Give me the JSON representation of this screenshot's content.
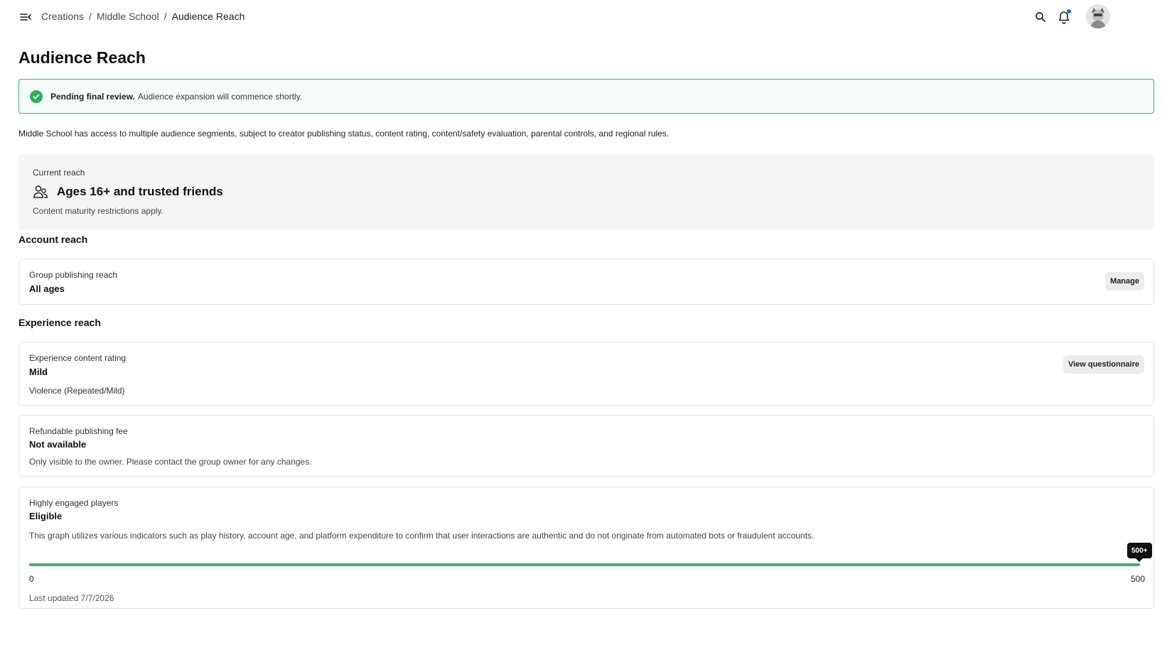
{
  "nav": {
    "menu_icon": "menu-collapse-icon",
    "breadcrumb": [
      "Creations",
      "Middle School",
      "Audience Reach"
    ],
    "separator": "/",
    "search_icon": "search-icon",
    "bell_icon": "bell-icon",
    "notification_dot_color": "#335fff"
  },
  "page": {
    "title": "Audience Reach"
  },
  "alert": {
    "icon": "check-circle-icon",
    "title": "Pending final review.",
    "text": "Audience expansion will commence shortly.",
    "color": "#3cb36a"
  },
  "intro": "Middle School has access to multiple audience segments, subject to creator publishing status, content rating, content/safety evaluation, parental controls, and regional rules.",
  "current_reach": {
    "label": "Current reach",
    "icon": "people-icon",
    "value": "Ages 16+ and trusted friends",
    "note": "Content maturity restrictions apply."
  },
  "account_reach": {
    "heading": "Account reach",
    "group": {
      "label": "Group publishing reach",
      "value": "All ages",
      "button": "Manage"
    }
  },
  "experience_reach": {
    "heading": "Experience reach",
    "rating": {
      "label": "Experience content rating",
      "value": "Mild",
      "descriptor": "Violence (Repeated/Mild)",
      "button": "View questionnaire"
    },
    "fee": {
      "label": "Refundable publishing fee",
      "value": "Not available",
      "text": "Only visible to the owner. Please contact the group owner for any changes."
    },
    "engaged": {
      "label": "Highly engaged players",
      "value": "Eligible",
      "text": "This graph utilizes various indicators such as play history, account age, and platform expenditure to confirm that user interactions are authentic and do not originate from automated bots or fraudulent accounts.",
      "progress_fraction": 1.0,
      "tooltip": "500+",
      "scale_min": "0",
      "scale_max": "500",
      "updated": "Last updated 7/7/2026",
      "bar_color": "#3cb36a"
    }
  }
}
